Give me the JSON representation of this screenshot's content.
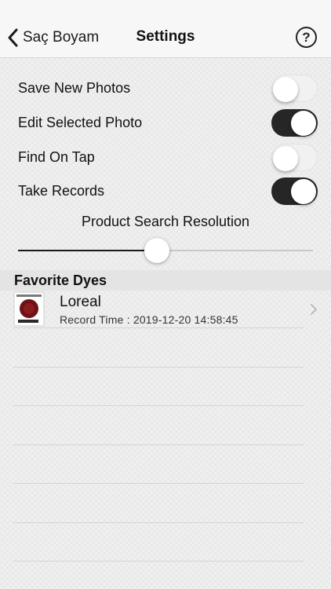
{
  "navbar": {
    "back_label": "Saç Boyam",
    "title": "Settings",
    "help_symbol": "?"
  },
  "settings": [
    {
      "label": "Save New Photos",
      "enabled": false
    },
    {
      "label": "Edit Selected Photo",
      "enabled": true
    },
    {
      "label": "Find On Tap",
      "enabled": false
    },
    {
      "label": "Take Records",
      "enabled": true
    }
  ],
  "resolution": {
    "title": "Product Search Resolution",
    "value_fraction": 0.47
  },
  "favorites": {
    "header": "Favorite Dyes",
    "items": [
      {
        "name": "Loreal",
        "record_time": "Record Time : 2019-12-20 14:58:45",
        "thumbnail": "hair-dye-box-icon"
      }
    ]
  },
  "colors": {
    "toggle_on": "#262626",
    "slider_fill": "#1a1a1a",
    "section_header_bg": "#e4e4e4"
  }
}
